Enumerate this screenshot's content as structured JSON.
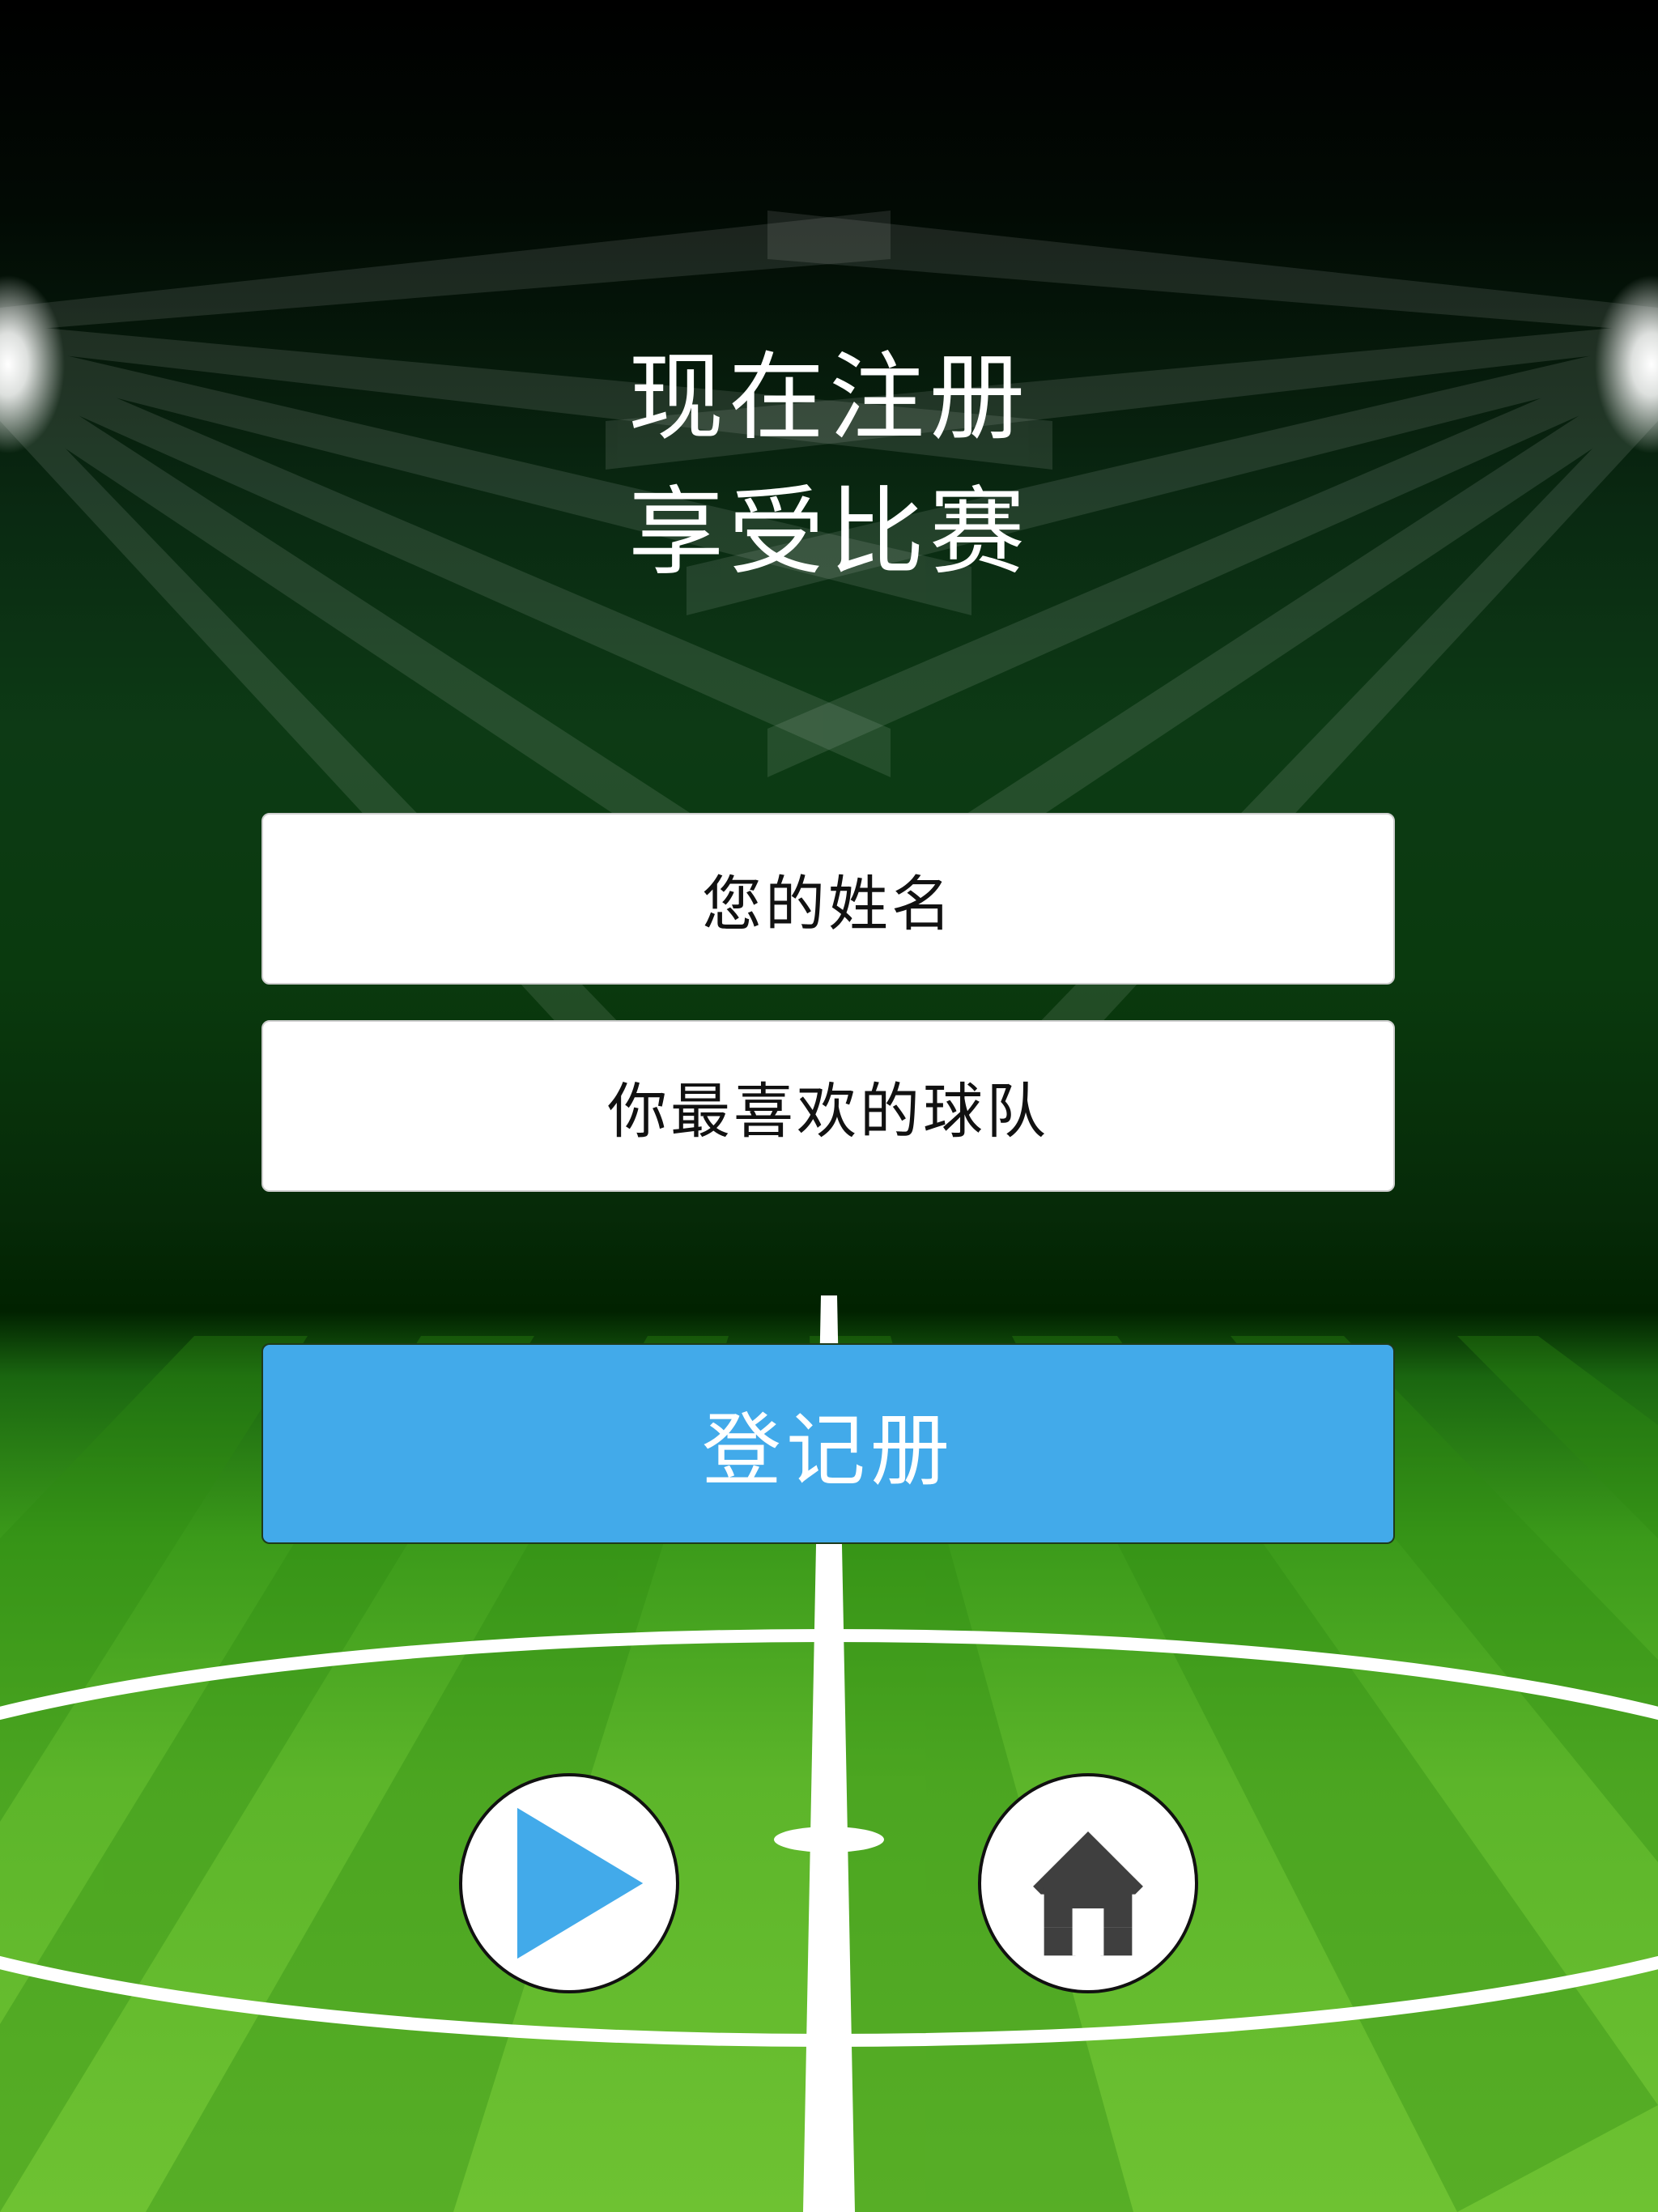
{
  "headline": {
    "line1": "现在注册",
    "line2": "享受比赛"
  },
  "form": {
    "name_field": "您的姓名",
    "team_field": "你最喜欢的球队",
    "register_label": "登记册"
  },
  "controls": {
    "play_icon": "play-icon",
    "home_icon": "home-icon"
  },
  "colors": {
    "accent": "#42aaea",
    "pitch_green": "#5cb52a",
    "home_icon": "#3f3f3f"
  }
}
